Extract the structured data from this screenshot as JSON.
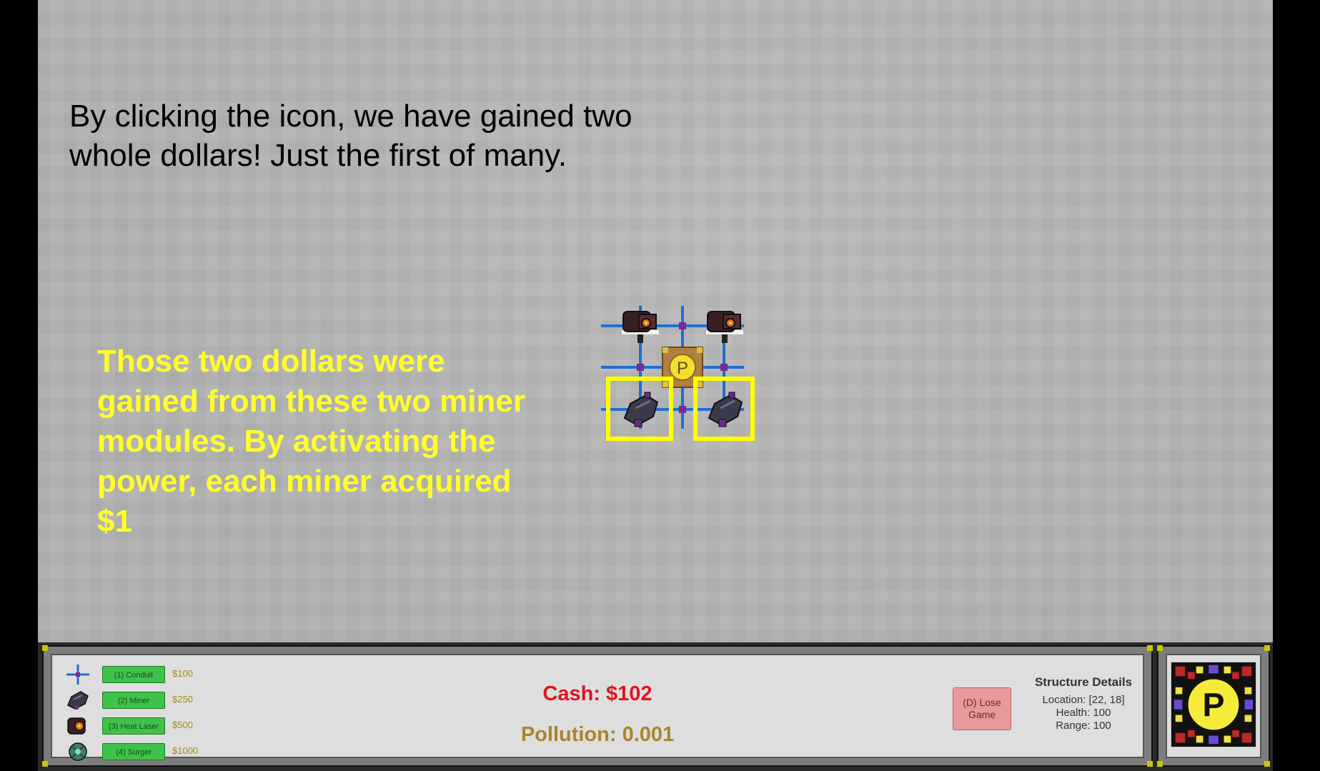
{
  "tutorial": {
    "intro": "By clicking the icon, we have gained two whole dollars! Just the first of many.",
    "callout": "Those two dollars were gained from these two miner modules. By activating the power, each miner acquired $1"
  },
  "grid": {
    "power_core_letter": "P",
    "highlight_color": "#ffff00"
  },
  "build_menu": [
    {
      "icon": "conduit-icon",
      "label": "(1) Conduit",
      "cost": "$100"
    },
    {
      "icon": "miner-icon",
      "label": "(2) Miner",
      "cost": "$250"
    },
    {
      "icon": "heat-laser-icon",
      "label": "(3) Heat Laser",
      "cost": "$500"
    },
    {
      "icon": "surger-icon",
      "label": "(4) Surger",
      "cost": "$1000"
    }
  ],
  "status": {
    "cash": "Cash: $102",
    "pollution": "Pollution: 0.001"
  },
  "lose_button": "(D) Lose Game",
  "structure_details": {
    "title": "Structure Details",
    "location": "Location:  [22, 18]",
    "health": "Health:  100",
    "range": "Range:  100"
  },
  "emblem_letter": "P",
  "colors": {
    "cash": "#e0141f",
    "pollution": "#a8862a",
    "callout": "#ffff2a",
    "build_button": "#3fc24a",
    "lose_button": "#e89a9a"
  }
}
